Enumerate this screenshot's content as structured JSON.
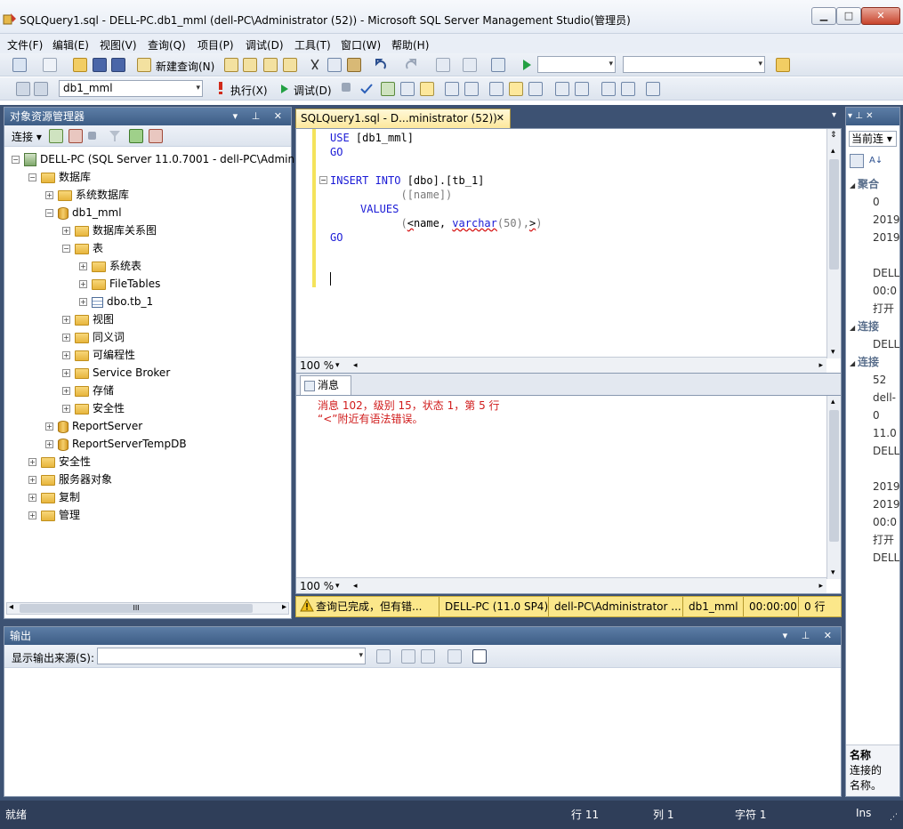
{
  "window": {
    "title": "SQLQuery1.sql - DELL-PC.db1_mml (dell-PC\\Administrator (52)) - Microsoft SQL Server Management Studio(管理员)",
    "minimize": "▁",
    "maximize": "□",
    "close": "✕"
  },
  "menu": [
    "文件(F)",
    "编辑(E)",
    "视图(V)",
    "查询(Q)",
    "项目(P)",
    "调试(D)",
    "工具(T)",
    "窗口(W)",
    "帮助(H)"
  ],
  "toolbar1": {
    "new_query": "新建查询(N)"
  },
  "toolbar2": {
    "database": "db1_mml",
    "execute": "执行(X)",
    "debug": "调试(D)"
  },
  "object_explorer": {
    "title": "对象资源管理器",
    "connect": "连接",
    "header_controls": "▾ ⊥ ✕",
    "tree": [
      {
        "label": "DELL-PC (SQL Server 11.0.7001 - dell-PC\\Administrator)",
        "level": 0,
        "exp": "−",
        "icon": "server"
      },
      {
        "label": "数据库",
        "level": 1,
        "exp": "−",
        "icon": "folder"
      },
      {
        "label": "系统数据库",
        "level": 2,
        "exp": "+",
        "icon": "folder"
      },
      {
        "label": "db1_mml",
        "level": 2,
        "exp": "−",
        "icon": "db"
      },
      {
        "label": "数据库关系图",
        "level": 3,
        "exp": "+",
        "icon": "folder"
      },
      {
        "label": "表",
        "level": 3,
        "exp": "−",
        "icon": "folder"
      },
      {
        "label": "系统表",
        "level": 4,
        "exp": "+",
        "icon": "folder"
      },
      {
        "label": "FileTables",
        "level": 4,
        "exp": "+",
        "icon": "folder"
      },
      {
        "label": "dbo.tb_1",
        "level": 4,
        "exp": "+",
        "icon": "table"
      },
      {
        "label": "视图",
        "level": 3,
        "exp": "+",
        "icon": "folder"
      },
      {
        "label": "同义词",
        "level": 3,
        "exp": "+",
        "icon": "folder"
      },
      {
        "label": "可编程性",
        "level": 3,
        "exp": "+",
        "icon": "folder"
      },
      {
        "label": "Service Broker",
        "level": 3,
        "exp": "+",
        "icon": "folder"
      },
      {
        "label": "存储",
        "level": 3,
        "exp": "+",
        "icon": "folder"
      },
      {
        "label": "安全性",
        "level": 3,
        "exp": "+",
        "icon": "folder"
      },
      {
        "label": "ReportServer",
        "level": 2,
        "exp": "+",
        "icon": "db"
      },
      {
        "label": "ReportServerTempDB",
        "level": 2,
        "exp": "+",
        "icon": "db"
      },
      {
        "label": "安全性",
        "level": 1,
        "exp": "+",
        "icon": "folder"
      },
      {
        "label": "服务器对象",
        "level": 1,
        "exp": "+",
        "icon": "folder"
      },
      {
        "label": "复制",
        "level": 1,
        "exp": "+",
        "icon": "folder"
      },
      {
        "label": "管理",
        "level": 1,
        "exp": "+",
        "icon": "folder"
      }
    ],
    "hscroll_thumb": "III"
  },
  "editor": {
    "tab_label": "SQLQuery1.sql - D...ministrator (52))",
    "tab_close": "✕",
    "code": {
      "l1_kw": "USE",
      "l1_rest": " [db1_mml]",
      "l2_kw": "GO",
      "l3_kw": "INSERT INTO",
      "l3_rest": " [dbo].[tb_1]",
      "l4": "           ([name])",
      "l5_kw": "VALUES",
      "l6_open": "           (",
      "l6_lt": "<",
      "l6_name": "name, ",
      "l6_type": "varchar",
      "l6_tail": "(50),",
      "l6_gt": ">",
      "l6_close": ")",
      "l7_kw": "GO"
    },
    "zoom": "100 %"
  },
  "messages": {
    "tab_label": "消息",
    "line1": "消息 102，级别 15，状态 1，第 5 行",
    "line2": "“<”附近有语法错误。",
    "zoom": "100 %"
  },
  "query_status": {
    "text": "查询已完成，但有错...",
    "server": "DELL-PC (11.0 SP4)",
    "user": "dell-PC\\Administrator ...",
    "database": "db1_mml",
    "time": "00:00:00",
    "rows": "0 行"
  },
  "properties": {
    "dropdown": "当前连",
    "rows": [
      {
        "text": "聚合",
        "cat": true
      },
      {
        "text": "0",
        "cat": false
      },
      {
        "text": "2019",
        "cat": false
      },
      {
        "text": "2019",
        "cat": false
      },
      {
        "text": "",
        "cat": false
      },
      {
        "text": "DELL",
        "cat": false
      },
      {
        "text": "00:0",
        "cat": false
      },
      {
        "text": "打开",
        "cat": false
      },
      {
        "text": "连接",
        "cat": true
      },
      {
        "text": "DELL",
        "cat": false
      },
      {
        "text": "连接",
        "cat": true
      },
      {
        "text": "52",
        "cat": false
      },
      {
        "text": "dell-",
        "cat": false
      },
      {
        "text": "0",
        "cat": false
      },
      {
        "text": "11.0",
        "cat": false
      },
      {
        "text": "DELL",
        "cat": false
      },
      {
        "text": "",
        "cat": false
      },
      {
        "text": "2019",
        "cat": false
      },
      {
        "text": "2019",
        "cat": false
      },
      {
        "text": "00:0",
        "cat": false
      },
      {
        "text": "打开",
        "cat": false
      },
      {
        "text": "DELL",
        "cat": false
      }
    ],
    "desc_title": "名称",
    "desc_line1": "连接的",
    "desc_line2": "名称。"
  },
  "output": {
    "title": "输出",
    "source_label": "显示输出来源(S):",
    "source_value": ""
  },
  "statusbar": {
    "ready": "就绪",
    "row": "行 11",
    "col": "列 1",
    "char": "字符 1",
    "ins": "Ins"
  },
  "colors": {
    "accent_header": "#3d5d85",
    "query_status_bg": "#fbe78a",
    "error_text": "#d01b1b",
    "keyword": "#1a1ad6"
  }
}
